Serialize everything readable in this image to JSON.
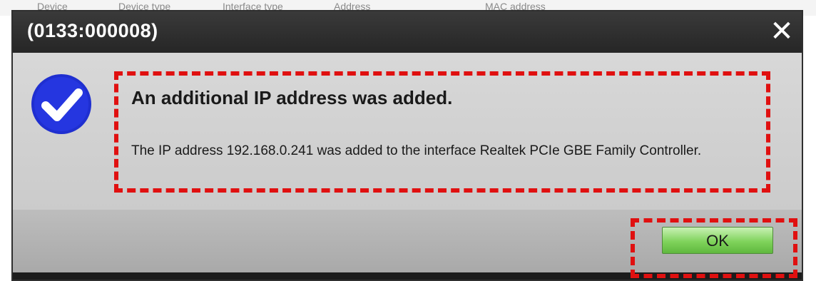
{
  "background_header": {
    "col1": "Device",
    "col2": "Device type",
    "col3": "Interface type",
    "col4": "Address",
    "col5": "MAC address"
  },
  "dialog": {
    "title": "(0133:000008)",
    "close_label": "✕",
    "status_icon": "checkmark-icon",
    "message_title": "An additional IP address was added.",
    "message_body": "The IP address 192.168.0.241 was added to the interface Realtek PCIe GBE Family Controller.",
    "ok_label": "OK"
  },
  "colors": {
    "titlebar": "#2b2b2b",
    "highlight_dashes": "#e01010",
    "ok_green": "#7fd35b",
    "icon_blue": "#1f2fd0"
  }
}
